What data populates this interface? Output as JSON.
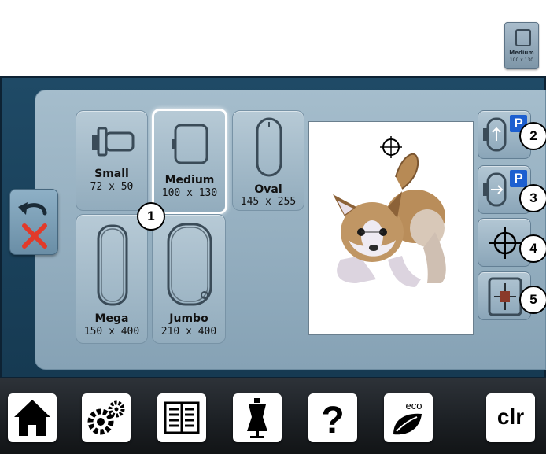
{
  "top_icon": {
    "name": "Medium",
    "size": "100 x 130"
  },
  "hoops": [
    {
      "name": "Small",
      "size": "72 x 50"
    },
    {
      "name": "Medium",
      "size": "100 x 130",
      "selected": true
    },
    {
      "name": "Oval",
      "size": "145 x 255"
    },
    {
      "name": "Mega",
      "size": "150 x 400"
    },
    {
      "name": "Jumbo",
      "size": "210 x 400"
    }
  ],
  "callouts": [
    "1",
    "2",
    "3",
    "4",
    "5"
  ],
  "side_buttons": {
    "p_label": "P"
  },
  "toolbar": {
    "eco_label": "eco",
    "clr_label": "clr",
    "help_label": "?"
  },
  "colors": {
    "accent_blue": "#1d5fd0",
    "close_red": "#e23a2a",
    "screen_blue": "#1f4a66"
  }
}
